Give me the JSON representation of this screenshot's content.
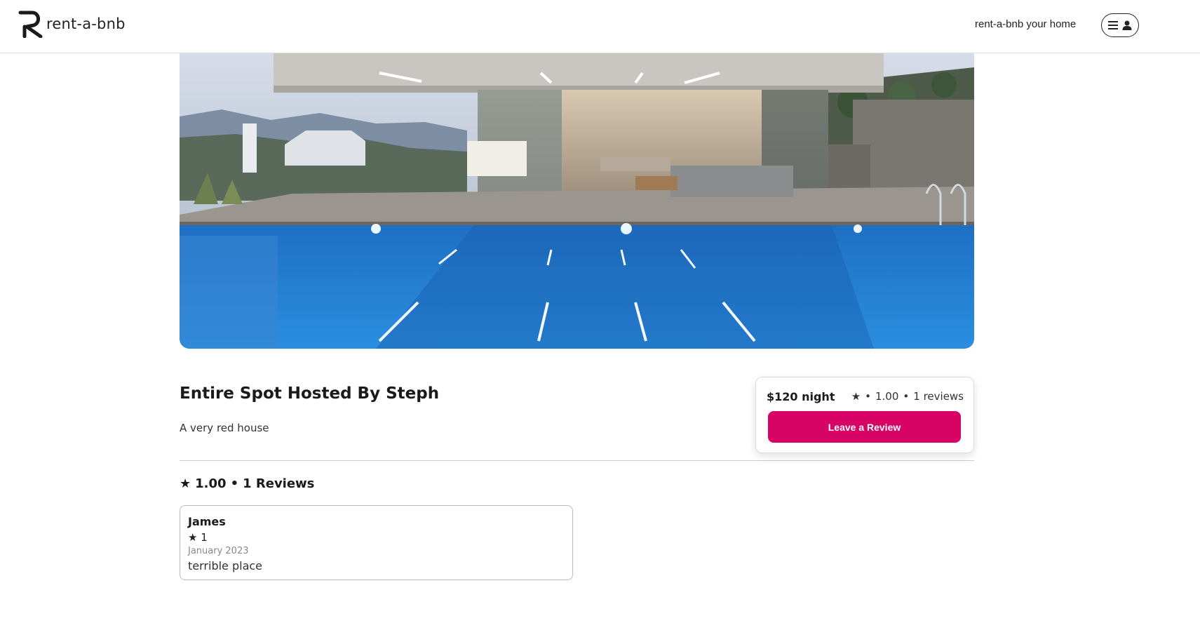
{
  "header": {
    "logo_text": "rent-a-bnb",
    "host_link": "rent-a-bnb your home",
    "icons": [
      "logo-icon",
      "menu-icon",
      "user-icon"
    ]
  },
  "spot": {
    "title": "Entire Spot Hosted By Steph",
    "description": "A very red house"
  },
  "booking": {
    "price": "$120 night",
    "star": "★",
    "sep1": "•",
    "rating": "1.00",
    "sep2": "•",
    "reviews": "1 reviews",
    "button_label": "Leave a Review",
    "accent_color": "#d70466"
  },
  "summary": {
    "star": "★",
    "rating": "1.00",
    "sep": "•",
    "reviews": "1 Reviews"
  },
  "reviews": [
    {
      "name": "James",
      "stars": "★ 1",
      "date": "January 2023",
      "text": "terrible place"
    }
  ]
}
